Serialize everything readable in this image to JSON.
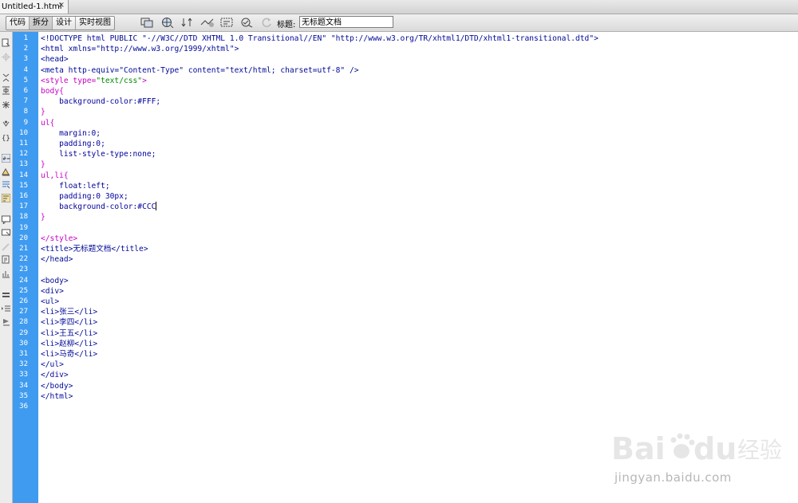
{
  "document_tab": {
    "name": "Untitled-1.html",
    "close_icon": "×"
  },
  "toolbar": {
    "view_buttons": [
      "代码",
      "拆分",
      "设计",
      "实时视图"
    ],
    "active_view": "拆分",
    "title_label": "标题:",
    "title_value": "无标题文档",
    "tool_icons": [
      "multiscreen-icon",
      "browser-preview-icon",
      "file-management-icon",
      "debug-icon",
      "visual-aids-icon",
      "validate-icon",
      "refresh-icon"
    ]
  },
  "sidebar_icons": [
    "open-documents-icon",
    "show-code-navigator-icon",
    "collapse-full-tag-icon",
    "collapse-selection-icon",
    "expand-all-icon",
    "select-parent-tag-icon",
    "balance-braces-icon",
    "line-numbers-icon",
    "highlight-invalid-code-icon",
    "syntax-coloring-icon",
    "word-wrap-icon",
    "info-bar-icon",
    "apply-comment-icon",
    "remove-comment-icon",
    "wrap-tag-icon",
    "recent-snippets-icon",
    "move-css-icon",
    "indent-code-icon",
    "outdent-code-icon",
    "format-source-icon"
  ],
  "code": {
    "lines": [
      "<!DOCTYPE html PUBLIC \"-//W3C//DTD XHTML 1.0 Transitional//EN\" \"http://www.w3.org/TR/xhtml1/DTD/xhtml1-transitional.dtd\">",
      "<html xmlns=\"http://www.w3.org/1999/xhtml\">",
      "<head>",
      "<meta http-equiv=\"Content-Type\" content=\"text/html; charset=utf-8\" />",
      "<style type=\"text/css\">",
      "body{",
      "    background-color:#FFF;",
      "}",
      "ul{",
      "    margin:0;",
      "    padding:0;",
      "    list-style-type:none;",
      "}",
      "ul,li{",
      "    float:left;",
      "    padding:0 30px;",
      "    background-color:#CCC",
      "}",
      "",
      "</style>",
      "<title>无标题文档</title>",
      "</head>",
      "",
      "<body>",
      "<div>",
      "<ul>",
      "<li>张三</li>",
      "<li>李四</li>",
      "<li>王五</li>",
      "<li>赵柳</li>",
      "<li>马奇</li>",
      "</ul>",
      "</div>",
      "</body>",
      "</html>",
      ""
    ],
    "caret_line": 17
  },
  "watermark": {
    "brand": "Bai du 经验",
    "url": "jingyan.baidu.com"
  },
  "colors": {
    "gutter": "#3f9bf0",
    "tag": "#000a96",
    "css": "#c800c8",
    "string": "#008b00"
  }
}
